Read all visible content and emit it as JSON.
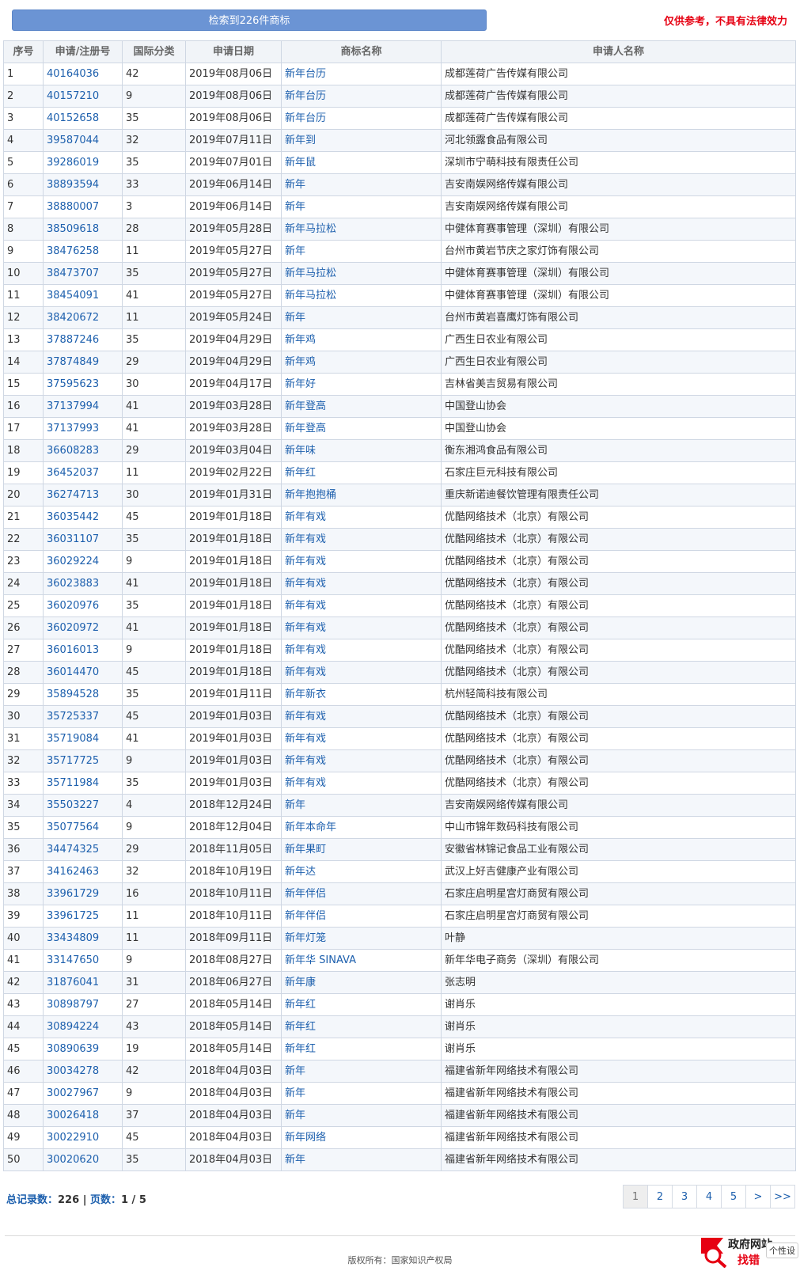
{
  "header": {
    "result_button": "检索到226件商标",
    "disclaimer": "仅供参考，不具有法律效力"
  },
  "table": {
    "columns": [
      "序号",
      "申请/注册号",
      "国际分类",
      "申请日期",
      "商标名称",
      "申请人名称"
    ],
    "rows": [
      [
        "1",
        "40164036",
        "42",
        "2019年08月06日",
        "新年台历",
        "成都莲荷广告传媒有限公司"
      ],
      [
        "2",
        "40157210",
        "9",
        "2019年08月06日",
        "新年台历",
        "成都莲荷广告传媒有限公司"
      ],
      [
        "3",
        "40152658",
        "35",
        "2019年08月06日",
        "新年台历",
        "成都莲荷广告传媒有限公司"
      ],
      [
        "4",
        "39587044",
        "32",
        "2019年07月11日",
        "新年到",
        "河北领露食品有限公司"
      ],
      [
        "5",
        "39286019",
        "35",
        "2019年07月01日",
        "新年鼠",
        "深圳市宁萌科技有限责任公司"
      ],
      [
        "6",
        "38893594",
        "33",
        "2019年06月14日",
        "新年",
        "吉安南娱网络传媒有限公司"
      ],
      [
        "7",
        "38880007",
        "3",
        "2019年06月14日",
        "新年",
        "吉安南娱网络传媒有限公司"
      ],
      [
        "8",
        "38509618",
        "28",
        "2019年05月28日",
        "新年马拉松",
        "中健体育赛事管理（深圳）有限公司"
      ],
      [
        "9",
        "38476258",
        "11",
        "2019年05月27日",
        "新年",
        "台州市黄岩节庆之家灯饰有限公司"
      ],
      [
        "10",
        "38473707",
        "35",
        "2019年05月27日",
        "新年马拉松",
        "中健体育赛事管理（深圳）有限公司"
      ],
      [
        "11",
        "38454091",
        "41",
        "2019年05月27日",
        "新年马拉松",
        "中健体育赛事管理（深圳）有限公司"
      ],
      [
        "12",
        "38420672",
        "11",
        "2019年05月24日",
        "新年",
        "台州市黄岩喜鹰灯饰有限公司"
      ],
      [
        "13",
        "37887246",
        "35",
        "2019年04月29日",
        "新年鸡",
        "广西生日农业有限公司"
      ],
      [
        "14",
        "37874849",
        "29",
        "2019年04月29日",
        "新年鸡",
        "广西生日农业有限公司"
      ],
      [
        "15",
        "37595623",
        "30",
        "2019年04月17日",
        "新年好",
        "吉林省美吉贸易有限公司"
      ],
      [
        "16",
        "37137994",
        "41",
        "2019年03月28日",
        "新年登高",
        "中国登山协会"
      ],
      [
        "17",
        "37137993",
        "41",
        "2019年03月28日",
        "新年登高",
        "中国登山协会"
      ],
      [
        "18",
        "36608283",
        "29",
        "2019年03月04日",
        "新年味",
        "衡东湘鸿食品有限公司"
      ],
      [
        "19",
        "36452037",
        "11",
        "2019年02月22日",
        "新年红",
        "石家庄巨元科技有限公司"
      ],
      [
        "20",
        "36274713",
        "30",
        "2019年01月31日",
        "新年抱抱桶",
        "重庆新诺迪餐饮管理有限责任公司"
      ],
      [
        "21",
        "36035442",
        "45",
        "2019年01月18日",
        "新年有戏",
        "优酷网络技术（北京）有限公司"
      ],
      [
        "22",
        "36031107",
        "35",
        "2019年01月18日",
        "新年有戏",
        "优酷网络技术（北京）有限公司"
      ],
      [
        "23",
        "36029224",
        "9",
        "2019年01月18日",
        "新年有戏",
        "优酷网络技术（北京）有限公司"
      ],
      [
        "24",
        "36023883",
        "41",
        "2019年01月18日",
        "新年有戏",
        "优酷网络技术（北京）有限公司"
      ],
      [
        "25",
        "36020976",
        "35",
        "2019年01月18日",
        "新年有戏",
        "优酷网络技术（北京）有限公司"
      ],
      [
        "26",
        "36020972",
        "41",
        "2019年01月18日",
        "新年有戏",
        "优酷网络技术（北京）有限公司"
      ],
      [
        "27",
        "36016013",
        "9",
        "2019年01月18日",
        "新年有戏",
        "优酷网络技术（北京）有限公司"
      ],
      [
        "28",
        "36014470",
        "45",
        "2019年01月18日",
        "新年有戏",
        "优酷网络技术（北京）有限公司"
      ],
      [
        "29",
        "35894528",
        "35",
        "2019年01月11日",
        "新年新衣",
        "杭州轻简科技有限公司"
      ],
      [
        "30",
        "35725337",
        "45",
        "2019年01月03日",
        "新年有戏",
        "优酷网络技术（北京）有限公司"
      ],
      [
        "31",
        "35719084",
        "41",
        "2019年01月03日",
        "新年有戏",
        "优酷网络技术（北京）有限公司"
      ],
      [
        "32",
        "35717725",
        "9",
        "2019年01月03日",
        "新年有戏",
        "优酷网络技术（北京）有限公司"
      ],
      [
        "33",
        "35711984",
        "35",
        "2019年01月03日",
        "新年有戏",
        "优酷网络技术（北京）有限公司"
      ],
      [
        "34",
        "35503227",
        "4",
        "2018年12月24日",
        "新年",
        "吉安南娱网络传媒有限公司"
      ],
      [
        "35",
        "35077564",
        "9",
        "2018年12月04日",
        "新年本命年",
        "中山市锦年数码科技有限公司"
      ],
      [
        "36",
        "34474325",
        "29",
        "2018年11月05日",
        "新年果町",
        "安徽省林锦记食品工业有限公司"
      ],
      [
        "37",
        "34162463",
        "32",
        "2018年10月19日",
        "新年达",
        "武汉上好吉健康产业有限公司"
      ],
      [
        "38",
        "33961729",
        "16",
        "2018年10月11日",
        "新年伴侣",
        "石家庄启明星宫灯商贸有限公司"
      ],
      [
        "39",
        "33961725",
        "11",
        "2018年10月11日",
        "新年伴侣",
        "石家庄启明星宫灯商贸有限公司"
      ],
      [
        "40",
        "33434809",
        "11",
        "2018年09月11日",
        "新年灯笼",
        "叶静"
      ],
      [
        "41",
        "33147650",
        "9",
        "2018年08月27日",
        "新年华 SINAVA",
        "新年华电子商务（深圳）有限公司"
      ],
      [
        "42",
        "31876041",
        "31",
        "2018年06月27日",
        "新年康",
        "张志明"
      ],
      [
        "43",
        "30898797",
        "27",
        "2018年05月14日",
        "新年红",
        "谢肖乐"
      ],
      [
        "44",
        "30894224",
        "43",
        "2018年05月14日",
        "新年红",
        "谢肖乐"
      ],
      [
        "45",
        "30890639",
        "19",
        "2018年05月14日",
        "新年红",
        "谢肖乐"
      ],
      [
        "46",
        "30034278",
        "42",
        "2018年04月03日",
        "新年",
        "福建省新年网络技术有限公司"
      ],
      [
        "47",
        "30027967",
        "9",
        "2018年04月03日",
        "新年",
        "福建省新年网络技术有限公司"
      ],
      [
        "48",
        "30026418",
        "37",
        "2018年04月03日",
        "新年",
        "福建省新年网络技术有限公司"
      ],
      [
        "49",
        "30022910",
        "45",
        "2018年04月03日",
        "新年网络",
        "福建省新年网络技术有限公司"
      ],
      [
        "50",
        "30020620",
        "35",
        "2018年04月03日",
        "新年",
        "福建省新年网络技术有限公司"
      ]
    ]
  },
  "footer": {
    "total_label": "总记录数：",
    "total_value": "226",
    "separator": "|",
    "pages_label": "页数：",
    "pages_value": "1 / 5",
    "pager": [
      "1",
      "2",
      "3",
      "4",
      "5",
      ">",
      ">>"
    ],
    "pager_active": "1"
  },
  "copyright": "版权所有：国家知识产权局",
  "gov_badge": {
    "line1": "政府网站",
    "line2": "找错",
    "tooltip": "个性设"
  },
  "colors": {
    "link": "#1c5fad",
    "disclaimer": "#e60012",
    "button": "#6b94d4"
  }
}
